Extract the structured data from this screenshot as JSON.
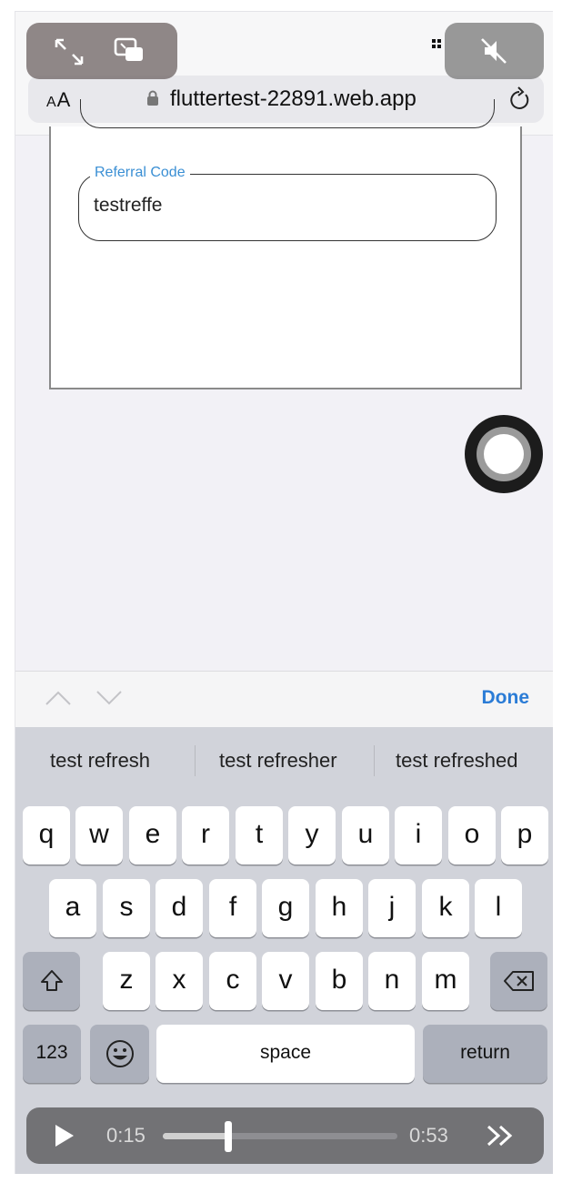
{
  "browser": {
    "text_size_label": "AA",
    "url": "fluttertest-22891.web.app"
  },
  "form": {
    "referral_label": "Referral Code",
    "referral_value": "testreffe"
  },
  "accessory": {
    "done_label": "Done"
  },
  "keyboard": {
    "suggestions": [
      "test refresh",
      "test refresher",
      "test refreshed"
    ],
    "row1": [
      "q",
      "w",
      "e",
      "r",
      "t",
      "y",
      "u",
      "i",
      "o",
      "p"
    ],
    "row2": [
      "a",
      "s",
      "d",
      "f",
      "g",
      "h",
      "j",
      "k",
      "l"
    ],
    "row3": [
      "z",
      "x",
      "c",
      "v",
      "b",
      "n",
      "m"
    ],
    "numbers_label": "123",
    "space_label": "space",
    "return_label": "return"
  },
  "player": {
    "current_time": "0:15",
    "total_time": "0:53",
    "progress": 0.28
  },
  "colors": {
    "link_blue": "#2b7cd6",
    "field_label_blue": "#3a8fd4",
    "keyboard_bg": "#d1d3da"
  }
}
